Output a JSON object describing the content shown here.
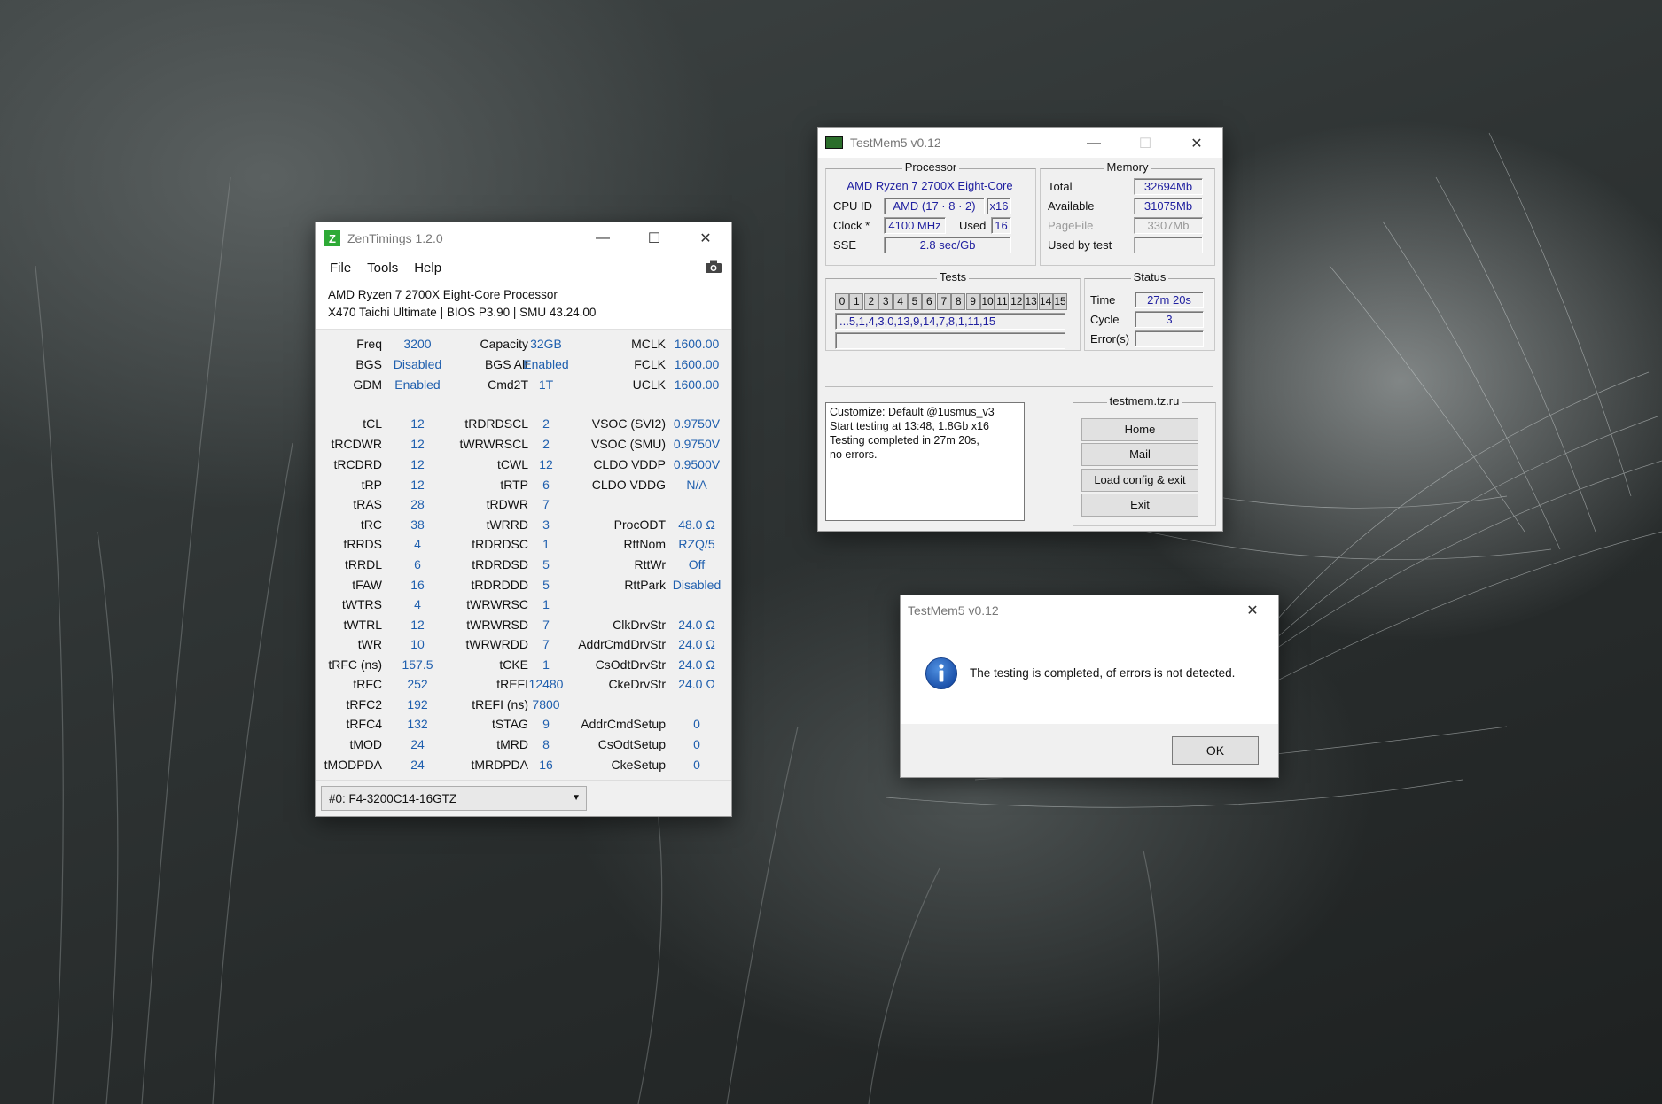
{
  "zentimings": {
    "title": "ZenTimings 1.2.0",
    "menu": [
      "File",
      "Tools",
      "Help"
    ],
    "cpu": "AMD Ryzen 7 2700X Eight-Core Processor",
    "board": "X470 Taichi Ultimate | BIOS P3.90 | SMU 43.24.00",
    "module": "#0: F4-3200C14-16GTZ",
    "rows": [
      [
        "Freq",
        "3200",
        "Capacity",
        "32GB",
        "MCLK",
        "1600.00"
      ],
      [
        "BGS",
        "Disabled",
        "BGS Alt",
        "Enabled",
        "FCLK",
        "1600.00"
      ],
      [
        "GDM",
        "Enabled",
        "Cmd2T",
        "1T",
        "UCLK",
        "1600.00"
      ],
      [
        "tCL",
        "12",
        "tRDRDSCL",
        "2",
        "VSOC (SVI2)",
        "0.9750V"
      ],
      [
        "tRCDWR",
        "12",
        "tWRWRSCL",
        "2",
        "VSOC (SMU)",
        "0.9750V"
      ],
      [
        "tRCDRD",
        "12",
        "tCWL",
        "12",
        "CLDO VDDP",
        "0.9500V"
      ],
      [
        "tRP",
        "12",
        "tRTP",
        "6",
        "CLDO VDDG",
        "N/A"
      ],
      [
        "tRAS",
        "28",
        "tRDWR",
        "7",
        "",
        ""
      ],
      [
        "tRC",
        "38",
        "tWRRD",
        "3",
        "ProcODT",
        "48.0 Ω"
      ],
      [
        "tRRDS",
        "4",
        "tRDRDSC",
        "1",
        "RttNom",
        "RZQ/5"
      ],
      [
        "tRRDL",
        "6",
        "tRDRDSD",
        "5",
        "RttWr",
        "Off"
      ],
      [
        "tFAW",
        "16",
        "tRDRDDD",
        "5",
        "RttPark",
        "Disabled"
      ],
      [
        "tWTRS",
        "4",
        "tWRWRSC",
        "1",
        "",
        ""
      ],
      [
        "tWTRL",
        "12",
        "tWRWRSD",
        "7",
        "ClkDrvStr",
        "24.0 Ω"
      ],
      [
        "tWR",
        "10",
        "tWRWRDD",
        "7",
        "AddrCmdDrvStr",
        "24.0 Ω"
      ],
      [
        "tRFC (ns)",
        "157.5",
        "tCKE",
        "1",
        "CsOdtDrvStr",
        "24.0 Ω"
      ],
      [
        "tRFC",
        "252",
        "tREFI",
        "12480",
        "CkeDrvStr",
        "24.0 Ω"
      ],
      [
        "tRFC2",
        "192",
        "tREFI (ns)",
        "7800",
        "",
        ""
      ],
      [
        "tRFC4",
        "132",
        "tSTAG",
        "9",
        "AddrCmdSetup",
        "0"
      ],
      [
        "tMOD",
        "24",
        "tMRD",
        "8",
        "CsOdtSetup",
        "0"
      ],
      [
        "tMODPDA",
        "24",
        "tMRDPDA",
        "16",
        "CkeSetup",
        "0"
      ]
    ]
  },
  "testmem": {
    "title": "TestMem5 v0.12",
    "processor_title": "Processor",
    "cpu_name": "AMD Ryzen 7 2700X Eight-Core",
    "cpuid_label": "CPU ID",
    "cpuid_value": "AMD  (17 · 8 · 2)",
    "threads": "x16",
    "clock_label": "Clock *",
    "clock_value": "4100 MHz",
    "used_label": "Used",
    "used_value": "16",
    "sse_label": "SSE",
    "sse_value": "2.8 sec/Gb",
    "memory_title": "Memory",
    "total_label": "Total",
    "total_value": "32694Mb",
    "available_label": "Available",
    "available_value": "31075Mb",
    "pagefile_label": "PageFile",
    "pagefile_value": "3307Mb",
    "usedbytest_label": "Used by test",
    "tests_title": "Tests",
    "tests": [
      "0",
      "1",
      "2",
      "3",
      "4",
      "5",
      "6",
      "7",
      "8",
      "9",
      "10",
      "11",
      "12",
      "13",
      "14",
      "15"
    ],
    "sequence": "...5,1,4,3,0,13,9,14,7,8,1,11,15",
    "status_title": "Status",
    "time_label": "Time",
    "time_value": "27m 20s",
    "cycle_label": "Cycle",
    "cycle_value": "3",
    "errors_label": "Error(s)",
    "log": [
      "Customize: Default @1usmus_v3",
      "Start testing at 13:48, 1.8Gb x16",
      "Testing completed in 27m 20s,",
      "no errors."
    ],
    "site_title": "testmem.tz.ru",
    "buttons": [
      "Home",
      "Mail",
      "Load config & exit",
      "Exit"
    ]
  },
  "dialog": {
    "title": "TestMem5 v0.12",
    "message": "The testing is completed, of errors is not detected.",
    "ok_label": "OK"
  }
}
